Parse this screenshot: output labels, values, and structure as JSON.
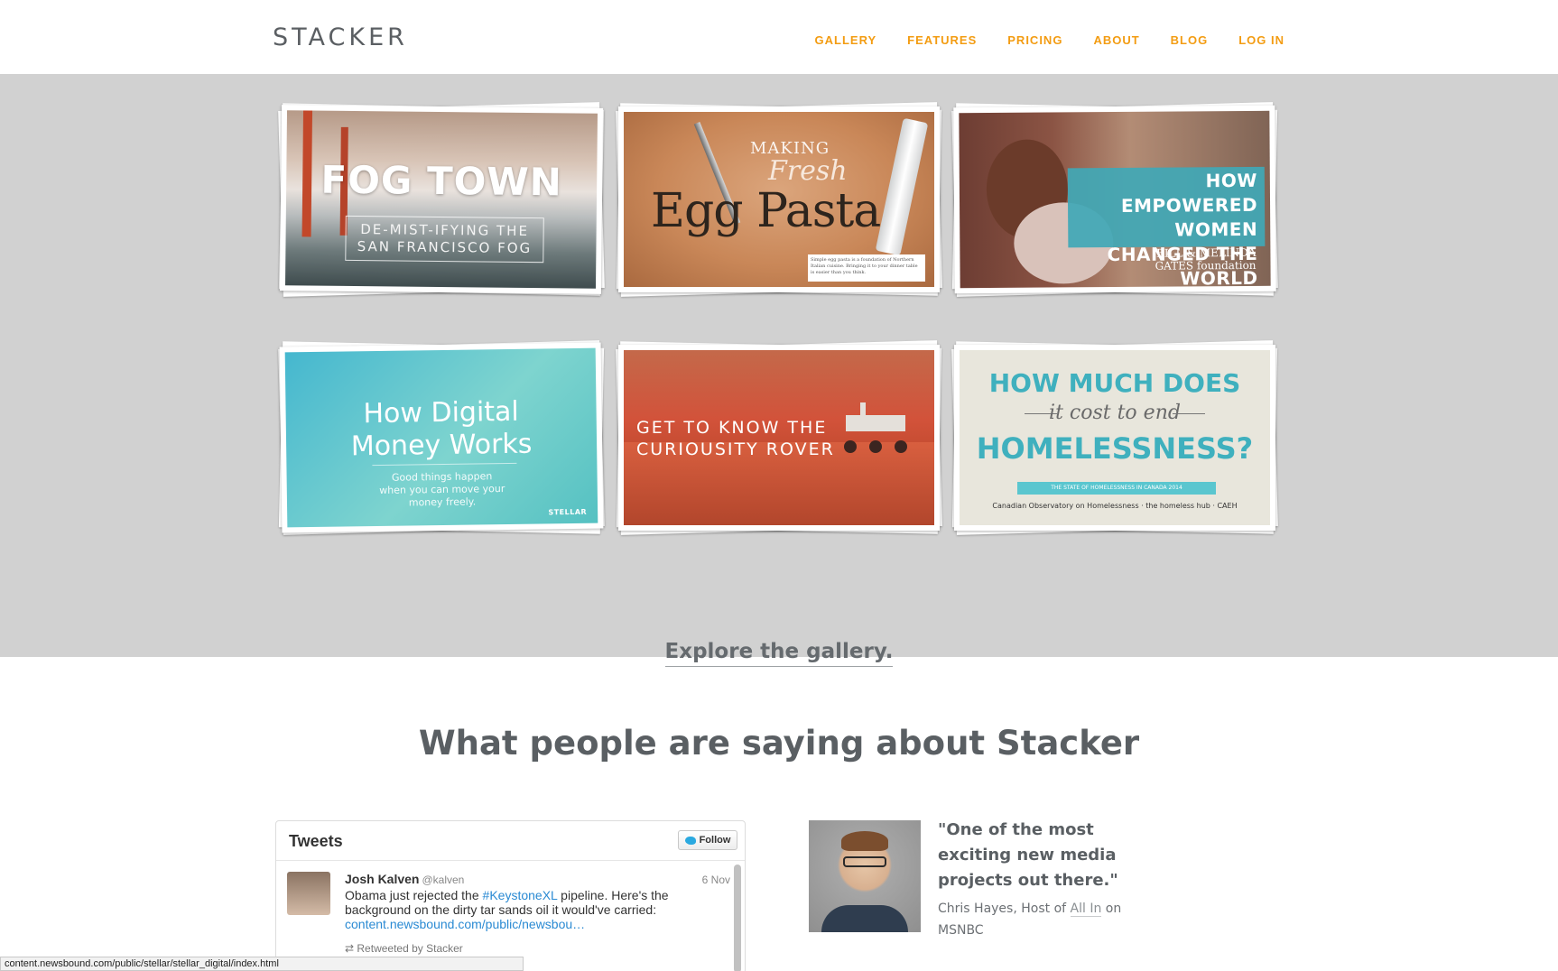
{
  "header": {
    "logo": "STACKER",
    "nav": [
      "GALLERY",
      "FEATURES",
      "PRICING",
      "ABOUT",
      "BLOG",
      "LOG IN"
    ]
  },
  "gallery": {
    "cards": [
      {
        "title": "FOG TOWN",
        "subtitle": "DE-MIST-IFYING THE SAN FRANCISCO FOG"
      },
      {
        "line1": "MAKING",
        "line2": "Fresh",
        "line3": "Egg Pasta",
        "note": "Simple egg pasta is a foundation of Northern Italian cuisine. Bringing it to your dinner table is easier than you think."
      },
      {
        "title": "HOW EMPOWERED WOMEN CHANGED THE WORLD",
        "logo": "BILL & MELINDA GATES foundation"
      },
      {
        "title": "How Digital Money Works",
        "subtitle": "Good things happen when you can move your money freely.",
        "brand": "STELLAR"
      },
      {
        "title": "GET TO KNOW THE CURIOUSITY ROVER"
      },
      {
        "line1": "HOW MUCH DOES",
        "line2": "it cost to end",
        "line3": "HOMELESSNESS?",
        "ribbon": "THE STATE OF HOMELESSNESS IN CANADA 2014",
        "logos": "Canadian Observatory on Homelessness · the homeless hub · CAEH"
      }
    ],
    "explore": "Explore the gallery."
  },
  "testimonials": {
    "title": "What people are saying about Stacker",
    "tweets_widget": {
      "title": "Tweets",
      "follow_label": "Follow",
      "tweet": {
        "name": "Josh Kalven",
        "handle": "@kalven",
        "date": "6 Nov",
        "text_before": "Obama just rejected the ",
        "hashtag": "#KeystoneXL",
        "text_after": " pipeline. Here's the background on the dirty tar sands oil it would've carried:",
        "link": "content.newsbound.com/public/newsbou…",
        "retweeted": "Retweeted by Stacker"
      }
    },
    "quote": "\"One of the most exciting new media projects out there.\"",
    "attribution_prefix": "Chris Hayes, Host of ",
    "attribution_show": "All In",
    "attribution_suffix": " on MSNBC"
  },
  "status_url": "content.newsbound.com/public/stellar/stellar_digital/index.html",
  "colors": {
    "accent": "#f39c12",
    "band": "#d1d1d1",
    "teal": "#3fb0be"
  }
}
